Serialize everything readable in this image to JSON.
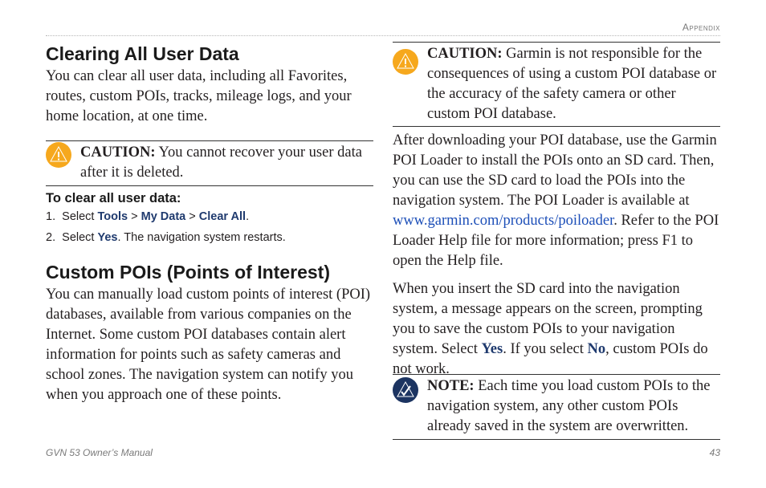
{
  "header": {
    "section": "Appendix"
  },
  "left": {
    "clearing": {
      "title": "Clearing All User Data",
      "intro": "You can clear all user data, including all Favorites, routes, custom POIs, tracks, mileage logs, and your home location, at one time.",
      "caution_label": "CAUTION:",
      "caution_text": " You cannot recover your user data after it is deleted.",
      "procedure_title": "To clear all user data:",
      "step1_num": "1.",
      "step1_prefix": "Select ",
      "step1_ui1": "Tools",
      "step1_sep1": " > ",
      "step1_ui2": "My Data",
      "step1_sep2": " > ",
      "step1_ui3": "Clear All",
      "step1_end": ".",
      "step2_num": "2.",
      "step2_prefix": "Select ",
      "step2_ui": "Yes",
      "step2_end": ". The navigation system restarts."
    },
    "custom_pois": {
      "title": "Custom POIs (Points of Interest)",
      "body": "You can manually load custom points of interest (POI) databases, available from various companies on the Internet. Some custom POI databases contain alert information for points such as safety cameras and school zones. The navigation system can notify you when you approach one of these points."
    }
  },
  "right": {
    "caution_label": "CAUTION:",
    "caution_text": " Garmin is not responsible for the consequences of using a custom POI database or the accuracy of the safety camera or other custom POI database.",
    "para1_before": "After downloading your POI database, use the Garmin POI Loader to install the POIs onto an SD card. Then, you can use the SD card to load the POIs into the navigation system. The POI Loader is available at ",
    "para1_link": "www.garmin.com/products/poiloader",
    "para1_after": ". Refer to the POI Loader Help file for more information; press F1 to open the Help file.",
    "para2_before": "When you insert the SD card into the navigation system, a message appears on the screen, prompting you to save the custom POIs to your navigation system. Select ",
    "para2_ui1": "Yes",
    "para2_mid": ". If you select ",
    "para2_ui2": "No",
    "para2_after": ", custom POIs do not work.",
    "note_label": "NOTE:",
    "note_text": " Each time you load custom POIs to the navigation system, any other custom POIs already saved in the system are overwritten."
  },
  "footer": {
    "manual": "GVN 53 Owner’s Manual",
    "page": "43"
  },
  "colors": {
    "caution": "#f6a81d",
    "note": "#1c3461",
    "ui_text": "#1f3a6e",
    "link": "#1d4fb8"
  }
}
